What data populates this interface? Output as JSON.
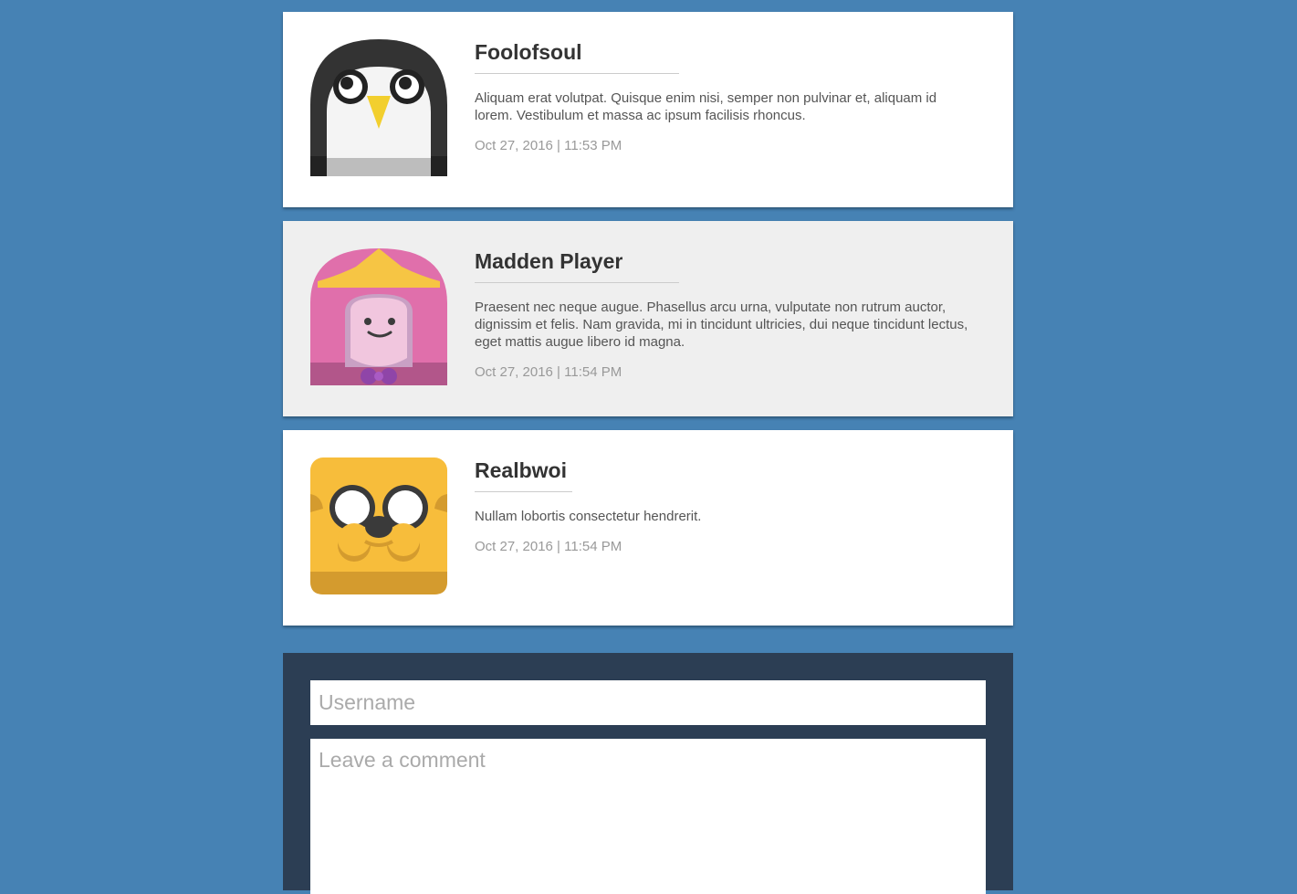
{
  "comments": [
    {
      "author": "Foolofsoul",
      "text": "Aliquam erat volutpat. Quisque enim nisi, semper non pulvinar et, aliquam id lorem. Vestibulum et massa ac ipsum facilisis rhoncus.",
      "date": "Oct 27, 2016 | 11:53 PM",
      "avatar_icon": "penguin-avatar-icon"
    },
    {
      "author": "Madden Player",
      "text": "Praesent nec neque augue. Phasellus arcu urna, vulputate non rutrum auctor, dignissim et felis. Nam gravida, mi in tincidunt ultricies, dui neque tincidunt lectus, eget mattis augue libero id magna.",
      "date": "Oct 27, 2016 | 11:54 PM",
      "avatar_icon": "princess-avatar-icon"
    },
    {
      "author": "Realbwoi",
      "text": "Nullam lobortis consectetur hendrerit.",
      "date": "Oct 27, 2016 | 11:54 PM",
      "avatar_icon": "dog-avatar-icon"
    }
  ],
  "form": {
    "username_placeholder": "Username",
    "comment_placeholder": "Leave a comment"
  },
  "colors": {
    "page_background": "#4682b4",
    "form_background": "#2c3e54",
    "card_background": "#ffffff",
    "card_alt_background": "#efefef"
  }
}
